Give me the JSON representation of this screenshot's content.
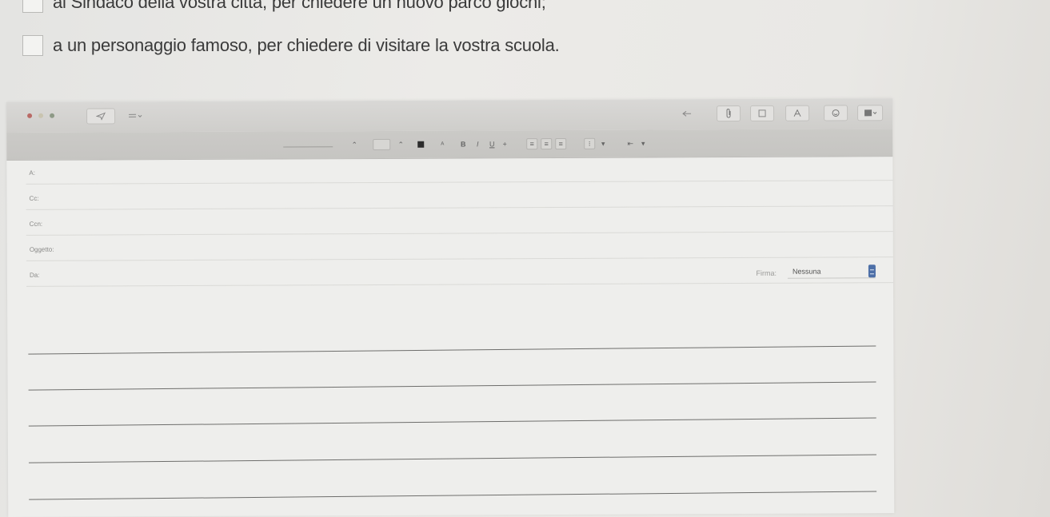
{
  "worksheet": {
    "choices": [
      {
        "text": "al Sindaco della vostra città, per chiedere un nuovo parco giochi;"
      },
      {
        "text": "a un personaggio famoso, per chiedere di visitare la vostra scuola."
      }
    ]
  },
  "mail": {
    "toolbar_icons": [
      "back-icon",
      "paperclip-icon",
      "attach-icon",
      "font-icon",
      "emoji-icon",
      "photo-icon"
    ],
    "format_icons": [
      "font-family",
      "font-size",
      "color",
      "bold",
      "italic",
      "underline",
      "strikethrough",
      "align-left",
      "align-center",
      "align-right",
      "list",
      "indent"
    ],
    "fields": [
      {
        "name": "to",
        "label": "A:"
      },
      {
        "name": "cc",
        "label": "Cc:"
      },
      {
        "name": "bcc",
        "label": "Ccn:"
      },
      {
        "name": "subject",
        "label": "Oggetto:"
      },
      {
        "name": "from",
        "label": "Da:"
      }
    ],
    "signature": {
      "label": "Firma:",
      "value": "Nessuna"
    }
  }
}
